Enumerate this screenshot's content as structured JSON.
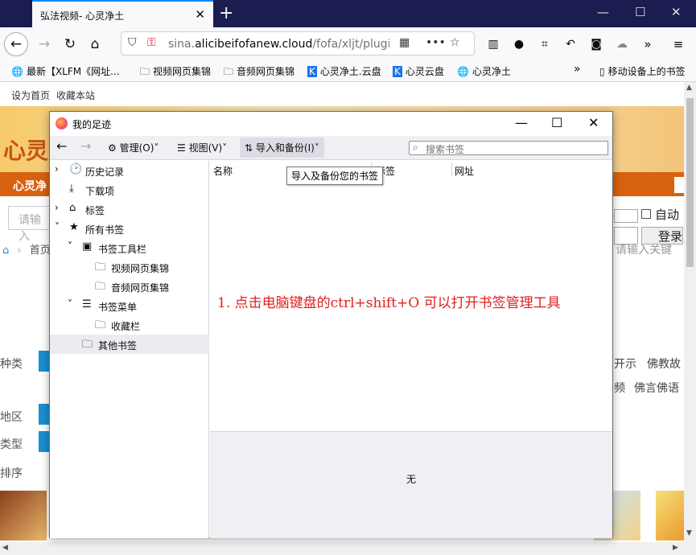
{
  "browser": {
    "tab_title": "弘法视频- 心灵净土",
    "url_prefix": "sina.",
    "url_domain": "alicibeifofanew.cloud",
    "url_path": "/fofa/xljt/plugin.p",
    "bookmarks": [
      "最新【XLFM《网址...",
      "视频网页集锦",
      "音频网页集锦",
      "心灵净土.云盘",
      "心灵云盘",
      "心灵净土",
      "移动设备上的书签"
    ]
  },
  "page": {
    "top_links": [
      "设为首页",
      "收藏本站"
    ],
    "logo": "心灵",
    "nav_text": "心灵净",
    "search_placeholder": "请输入",
    "breadcrumb": "首页",
    "keyword_placeholder": "请输入关键",
    "auto_login": "自动",
    "login_button": "登录",
    "filters": [
      "种类",
      "地区",
      "类型",
      "排序"
    ],
    "right_tags": [
      "开示",
      "佛教故",
      "频",
      "佛言佛语"
    ]
  },
  "dialog": {
    "title": "我的足迹",
    "toolbar": {
      "organize": "管理(O)",
      "views": "视图(V)",
      "import_backup": "导入和备份(I)",
      "search_placeholder": "搜索书签"
    },
    "tree": [
      {
        "label": "历史记录",
        "icon": "clock-icon"
      },
      {
        "label": "下载项",
        "icon": "download-icon"
      },
      {
        "label": "标签",
        "icon": "tag-icon"
      },
      {
        "label": "所有书签",
        "icon": "star-icon"
      },
      {
        "label": "书签工具栏",
        "icon": "toolbar-icon"
      },
      {
        "label": "视频网页集锦",
        "icon": "folder-icon"
      },
      {
        "label": "音频网页集锦",
        "icon": "folder-icon"
      },
      {
        "label": "书签菜单",
        "icon": "menu-icon"
      },
      {
        "label": "收藏栏",
        "icon": "folder-icon"
      },
      {
        "label": "其他书签",
        "icon": "folder-icon"
      }
    ],
    "columns": [
      "名称",
      "标签",
      "网址"
    ],
    "tooltip": "导入及备份您的书签",
    "annotation": "1. 点击电脑键盘的ctrl+shift+O    可以打开书签管理工具",
    "details_empty": "无"
  }
}
